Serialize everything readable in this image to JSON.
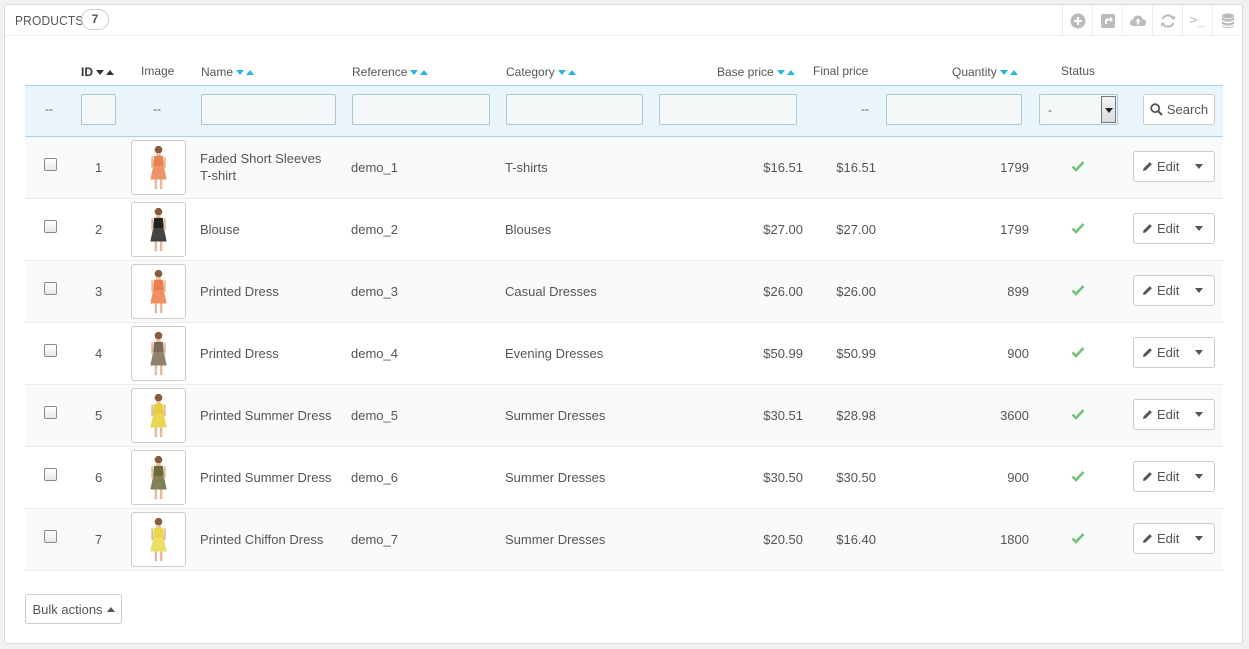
{
  "panel": {
    "title": "PRODUCTS",
    "count": "7"
  },
  "toolbar": {
    "icons": [
      "add-circle-icon",
      "export-icon",
      "cloud-upload-icon",
      "refresh-icon",
      "terminal-icon",
      "database-icon"
    ],
    "terminal_glyph": ">_"
  },
  "columns": {
    "id": "ID",
    "image": "Image",
    "name": "Name",
    "reference": "Reference",
    "category": "Category",
    "base_price": "Base price",
    "final_price": "Final price",
    "quantity": "Quantity",
    "status": "Status"
  },
  "filters": {
    "bulk_placeholder": "--",
    "image_placeholder": "--",
    "final_price_placeholder": "--",
    "status_value": "-",
    "search_label": "Search"
  },
  "rows": [
    {
      "id": "1",
      "name_line1": "Faded Short Sleeves",
      "name_line2": "T-shirt",
      "reference": "demo_1",
      "category": "T-shirts",
      "base_price": "$16.51",
      "final_price": "$16.51",
      "quantity": "1799",
      "dress_color": "#e8834e"
    },
    {
      "id": "2",
      "name_line1": "Blouse",
      "name_line2": "",
      "reference": "demo_2",
      "category": "Blouses",
      "base_price": "$27.00",
      "final_price": "$27.00",
      "quantity": "1799",
      "dress_color": "#222222"
    },
    {
      "id": "3",
      "name_line1": "Printed Dress",
      "name_line2": "",
      "reference": "demo_3",
      "category": "Casual Dresses",
      "base_price": "$26.00",
      "final_price": "$26.00",
      "quantity": "899",
      "dress_color": "#f07a4a"
    },
    {
      "id": "4",
      "name_line1": "Printed Dress",
      "name_line2": "",
      "reference": "demo_4",
      "category": "Evening Dresses",
      "base_price": "$50.99",
      "final_price": "$50.99",
      "quantity": "900",
      "dress_color": "#7d6a55"
    },
    {
      "id": "5",
      "name_line1": "Printed Summer Dress",
      "name_line2": "",
      "reference": "demo_5",
      "category": "Summer Dresses",
      "base_price": "$30.51",
      "final_price": "$28.98",
      "quantity": "3600",
      "dress_color": "#e6cf3a"
    },
    {
      "id": "6",
      "name_line1": "Printed Summer Dress",
      "name_line2": "",
      "reference": "demo_6",
      "category": "Summer Dresses",
      "base_price": "$30.50",
      "final_price": "$30.50",
      "quantity": "900",
      "dress_color": "#6b6b3a"
    },
    {
      "id": "7",
      "name_line1": "Printed Chiffon Dress",
      "name_line2": "",
      "reference": "demo_7",
      "category": "Summer Dresses",
      "base_price": "$20.50",
      "final_price": "$16.40",
      "quantity": "1800",
      "dress_color": "#e8d84a"
    }
  ],
  "row_actions": {
    "edit_label": "Edit"
  },
  "footer": {
    "bulk_actions_label": "Bulk actions"
  },
  "colors": {
    "accent": "#25b9d7",
    "status_ok": "#72c279",
    "filter_bg": "#eaf4fb"
  }
}
